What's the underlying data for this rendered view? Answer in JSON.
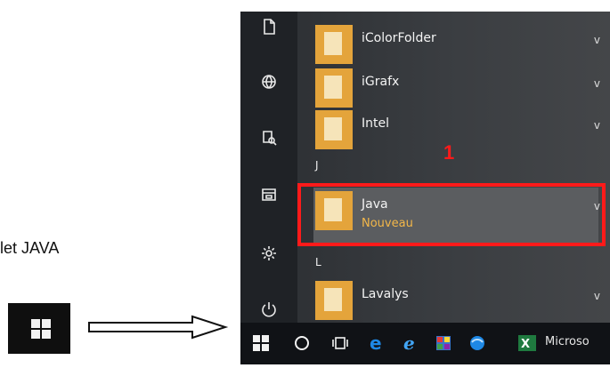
{
  "side_caption": "let JAVA",
  "start_menu": {
    "apps": [
      {
        "name": "iColorFolder",
        "chevron": "v"
      },
      {
        "name": "iGrafx",
        "chevron": "v"
      },
      {
        "name": "Intel",
        "chevron": "v"
      },
      {
        "name": "Java",
        "sub": "Nouveau",
        "chevron": "v"
      },
      {
        "name": "Lavalys",
        "chevron": "v"
      }
    ],
    "letters": [
      "J",
      "L"
    ],
    "rail_icons": [
      "document-icon",
      "globe-icon",
      "pictures-icon",
      "explorer-icon",
      "settings-icon",
      "power-icon"
    ]
  },
  "annotation": {
    "number": "1",
    "color": "#ff1a1a"
  },
  "taskbar": {
    "icons": [
      "windows-start-icon",
      "cortana-circle-icon",
      "task-view-icon",
      "edge-icon",
      "ie-icon",
      "paint-icon",
      "browser-globe-icon",
      "excel-icon"
    ],
    "label": "Microso"
  }
}
